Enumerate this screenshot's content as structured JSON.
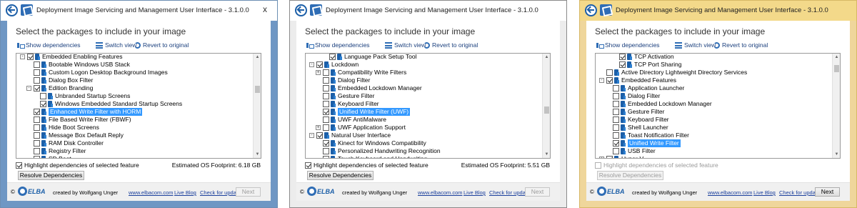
{
  "windows": [
    {
      "title": "Deployment Image Servicing and Management User Interface - 3.1.0.0",
      "close": "x",
      "heading": "Select the packages to include in your image",
      "toolbar": {
        "show_dependencies": "Show dependencies",
        "switch_view": "Switch view",
        "revert": "Revert to original"
      },
      "tree": [
        {
          "indent": 1,
          "expander": "-",
          "checked": true,
          "label": "Embedded Enabling Features",
          "selected": false
        },
        {
          "indent": 2,
          "expander": "",
          "checked": false,
          "label": "Bootable Windows USB Stack",
          "selected": false
        },
        {
          "indent": 2,
          "expander": "",
          "checked": false,
          "label": "Custom Logon Desktop Background Images",
          "selected": false
        },
        {
          "indent": 2,
          "expander": "",
          "checked": false,
          "label": "Dialog Box Filter",
          "selected": false
        },
        {
          "indent": 2,
          "expander": "-",
          "checked": true,
          "label": "Edition Branding",
          "selected": false
        },
        {
          "indent": 3,
          "expander": "",
          "checked": false,
          "label": "Unbranded Startup Screens",
          "selected": false
        },
        {
          "indent": 3,
          "expander": "",
          "checked": true,
          "label": "Windows Embedded Standard Startup Screens",
          "selected": false
        },
        {
          "indent": 2,
          "expander": "",
          "checked": true,
          "label": "Enhanced Write Filter with HORM",
          "selected": true
        },
        {
          "indent": 2,
          "expander": "",
          "checked": false,
          "label": "File Based Write Filter (FBWF)",
          "selected": false
        },
        {
          "indent": 2,
          "expander": "",
          "checked": false,
          "label": "Hide Boot Screens",
          "selected": false
        },
        {
          "indent": 2,
          "expander": "",
          "checked": false,
          "label": "Message Box Default Reply",
          "selected": false
        },
        {
          "indent": 2,
          "expander": "",
          "checked": false,
          "label": "RAM Disk Controller",
          "selected": false
        },
        {
          "indent": 2,
          "expander": "",
          "checked": false,
          "label": "Registry Filter",
          "selected": false
        },
        {
          "indent": 2,
          "expander": "",
          "checked": false,
          "label": "SD Boot",
          "selected": false
        }
      ],
      "scroll_fraction": 0.3,
      "highlight_label": "Highlight dependencies of selected feature",
      "highlight_checked": true,
      "highlight_disabled": false,
      "footprint": "Estimated OS Footprint: 6.18 GB",
      "resolve_label": "Resolve Dependencies",
      "resolve_disabled": false,
      "footer": {
        "copyright": "©",
        "brand": "ELBA",
        "created_by": "created by Wolfgang Unger",
        "website": "www.elbacom.com",
        "blog": "Live Blog",
        "update": "Check for update"
      },
      "next_label": "Next",
      "next_disabled": true
    },
    {
      "title": "Deployment Image Servicing and Management User Interface - 3.1.0.0",
      "close": "",
      "heading": "Select the packages to include in your image",
      "toolbar": {
        "show_dependencies": "Show dependencies",
        "switch_view": "Switch view",
        "revert": "Revert to original"
      },
      "tree": [
        {
          "indent": 3,
          "expander": "",
          "checked": true,
          "label": "Language Pack Setup Tool",
          "selected": false
        },
        {
          "indent": 1,
          "expander": "-",
          "checked": true,
          "label": "Lockdown",
          "selected": false
        },
        {
          "indent": 2,
          "expander": "+",
          "checked": false,
          "label": "Compatibility Write Filters",
          "selected": false
        },
        {
          "indent": 2,
          "expander": "",
          "checked": false,
          "label": "Dialog Filter",
          "selected": false
        },
        {
          "indent": 2,
          "expander": "",
          "checked": false,
          "label": "Embedded Lockdown Manager",
          "selected": false
        },
        {
          "indent": 2,
          "expander": "",
          "checked": false,
          "label": "Gesture Filter",
          "selected": false
        },
        {
          "indent": 2,
          "expander": "",
          "checked": false,
          "label": "Keyboard Filter",
          "selected": false
        },
        {
          "indent": 2,
          "expander": "",
          "checked": true,
          "label": "Unified Write Filter (UWF)",
          "selected": true
        },
        {
          "indent": 2,
          "expander": "",
          "checked": false,
          "label": "UWF AntiMalware",
          "selected": false
        },
        {
          "indent": 2,
          "expander": "+",
          "checked": false,
          "label": "UWF Application Support",
          "selected": false
        },
        {
          "indent": 1,
          "expander": "-",
          "checked": true,
          "label": "Natural User Interface",
          "selected": false
        },
        {
          "indent": 2,
          "expander": "",
          "checked": true,
          "label": "Kinect for Windows Compatibility",
          "selected": false
        },
        {
          "indent": 2,
          "expander": "",
          "checked": false,
          "label": "Personalized Handwriting Recognition",
          "selected": false
        },
        {
          "indent": 2,
          "expander": "",
          "checked": false,
          "label": "Touch Keyboard and Handwriting",
          "selected": false
        }
      ],
      "scroll_fraction": 0.55,
      "highlight_label": "Highlight dependencies of selected feature",
      "highlight_checked": true,
      "highlight_disabled": false,
      "footprint": "Estimated OS Footprint: 5.51 GB",
      "resolve_label": "Resolve Dependencies",
      "resolve_disabled": false,
      "footer": {
        "copyright": "©",
        "brand": "ELBA",
        "created_by": "created by Wolfgang Unger",
        "website": "www.elbacom.com",
        "blog": "Live Blog",
        "update": "Check for update"
      },
      "next_label": "Next",
      "next_disabled": true
    },
    {
      "title": "Deployment Image Servicing and Management User Interface - 3.1.0.0",
      "close": "",
      "heading": "Select the packages to include in your image",
      "toolbar": {
        "show_dependencies": "Show dependencies",
        "switch_view": "Switch view",
        "revert": "Revert to original"
      },
      "tree": [
        {
          "indent": 3,
          "expander": "",
          "checked": true,
          "label": "TCP Activation",
          "selected": false
        },
        {
          "indent": 3,
          "expander": "",
          "checked": true,
          "label": "TCP Port Sharing",
          "selected": false
        },
        {
          "indent": 1,
          "expander": "",
          "checked": false,
          "label": "Active Directory Lightweight Directory Services",
          "selected": false
        },
        {
          "indent": 1,
          "expander": "-",
          "checked": true,
          "label": "Embedded Features",
          "selected": false
        },
        {
          "indent": 2,
          "expander": "",
          "checked": false,
          "label": "Application Launcher",
          "selected": false
        },
        {
          "indent": 2,
          "expander": "",
          "checked": false,
          "label": "Dialog Filter",
          "selected": false
        },
        {
          "indent": 2,
          "expander": "",
          "checked": false,
          "label": "Embedded Lockdown Manager",
          "selected": false
        },
        {
          "indent": 2,
          "expander": "",
          "checked": false,
          "label": "Gesture Filter",
          "selected": false
        },
        {
          "indent": 2,
          "expander": "",
          "checked": false,
          "label": "Keyboard Filter",
          "selected": false
        },
        {
          "indent": 2,
          "expander": "",
          "checked": false,
          "label": "Shell Launcher",
          "selected": false
        },
        {
          "indent": 2,
          "expander": "",
          "checked": false,
          "label": "Toast Notification Filter",
          "selected": false
        },
        {
          "indent": 2,
          "expander": "",
          "checked": true,
          "label": "Unified Write Filter",
          "selected": true
        },
        {
          "indent": 2,
          "expander": "",
          "checked": false,
          "label": "USB Filter",
          "selected": false
        },
        {
          "indent": 1,
          "expander": "+",
          "checked": true,
          "label": "Hyper-V",
          "selected": false
        }
      ],
      "scroll_fraction": 0.05,
      "highlight_label": "Highlight dependencies of selected feature",
      "highlight_checked": false,
      "highlight_disabled": true,
      "footprint": "",
      "resolve_label": "Resolve Dependencies",
      "resolve_disabled": true,
      "footer": {
        "copyright": "©",
        "brand": "ELBA",
        "created_by": "created by Wolfgang Unger",
        "website": "www.elbacom.com",
        "blog": "Live Blog",
        "update": "Check for update"
      },
      "next_label": "Next",
      "next_disabled": false
    }
  ]
}
